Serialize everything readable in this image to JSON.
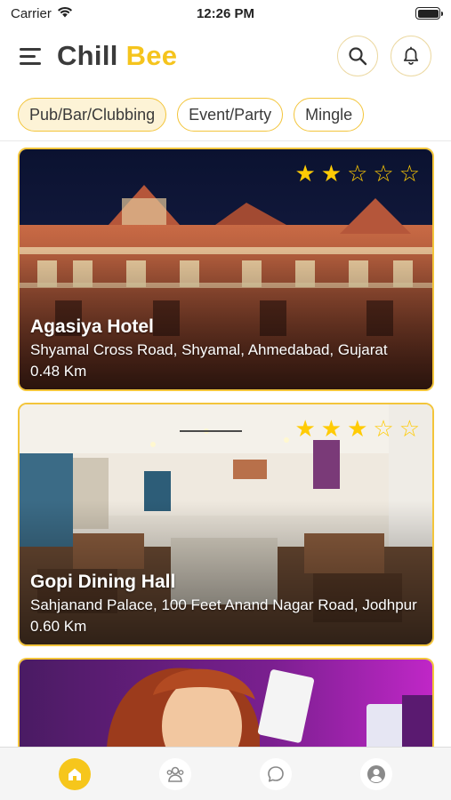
{
  "status_bar": {
    "carrier": "Carrier",
    "time": "12:26 PM",
    "battery_level": 1.0
  },
  "header": {
    "logo_part1": "Chill ",
    "logo_part2": "Bee",
    "menu_icon": "hamburger-menu-icon",
    "search_icon": "search-icon",
    "notification_icon": "bell-icon"
  },
  "chips": [
    {
      "label": "Pub/Bar/Clubbing",
      "active": true
    },
    {
      "label": "Event/Party",
      "active": false
    },
    {
      "label": "Mingle",
      "active": false
    }
  ],
  "venues": [
    {
      "name": "Agasiya Hotel",
      "address": "Shyamal Cross Road, Shyamal, Ahmedabad, Gujarat",
      "distance": "0.48 Km",
      "rating": 2,
      "max_rating": 5
    },
    {
      "name": "Gopi Dining Hall",
      "address": "Sahjanand Palace, 100 Feet Anand Nagar Road, Jodhpur",
      "distance": "0.60 Km",
      "rating": 3,
      "max_rating": 5
    },
    {
      "name": "",
      "address": "",
      "distance": "",
      "rating": 0,
      "max_rating": 5
    }
  ],
  "bottom_nav": [
    {
      "icon": "home-icon",
      "active": true
    },
    {
      "icon": "people-icon",
      "active": false
    },
    {
      "icon": "chat-icon",
      "active": false
    },
    {
      "icon": "profile-icon",
      "active": false
    }
  ],
  "colors": {
    "accent": "#f6c61c",
    "chip_border": "#f3c53b",
    "star": "#ffcb05",
    "logo_dark": "#3b3b3b"
  }
}
